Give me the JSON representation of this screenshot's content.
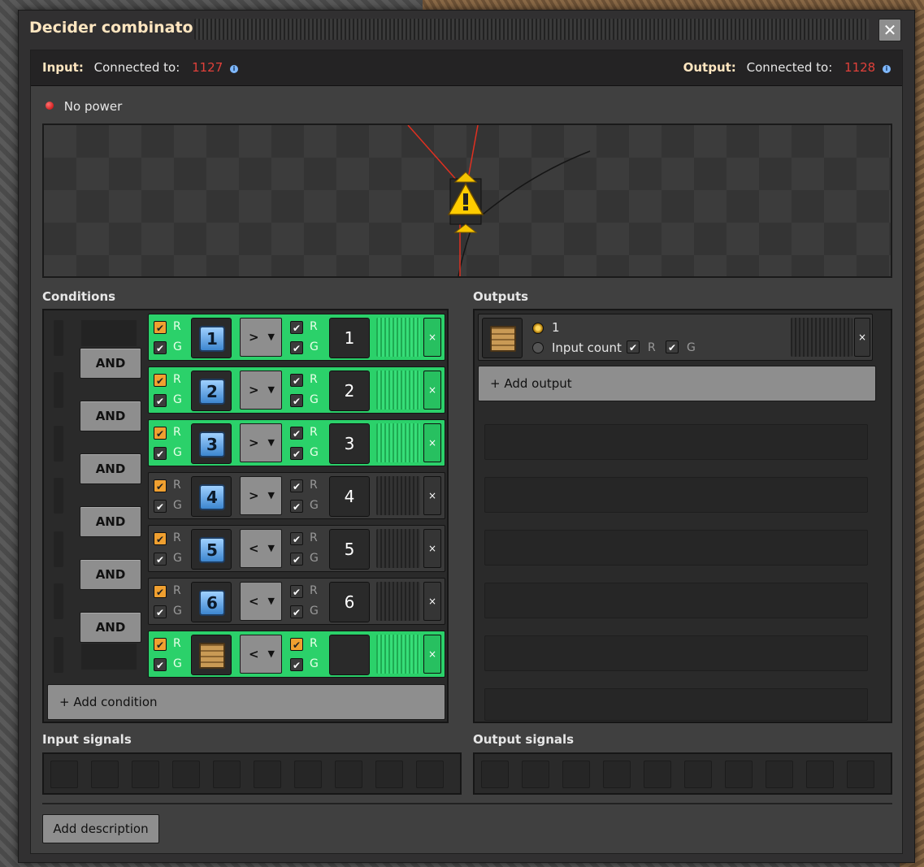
{
  "window": {
    "title": "Decider combinator",
    "close_label": "✕"
  },
  "connections": {
    "input": {
      "label": "Input:",
      "text": "Connected to:",
      "network_id": "1127"
    },
    "output": {
      "label": "Output:",
      "text": "Connected to:",
      "network_id": "1128"
    }
  },
  "status": {
    "text": "No power",
    "color": "#e02020"
  },
  "sections": {
    "conditions": "Conditions",
    "outputs": "Outputs",
    "input_signals": "Input signals",
    "output_signals": "Output signals"
  },
  "conditions": {
    "joiner_label": "AND",
    "add_label": "+ Add condition",
    "remove_label": "×",
    "rows": [
      {
        "signal": "1",
        "signal_icon": "signal-1-icon",
        "comparator": ">",
        "constant": "1",
        "active": true
      },
      {
        "signal": "2",
        "signal_icon": "signal-2-icon",
        "comparator": ">",
        "constant": "2",
        "active": true
      },
      {
        "signal": "3",
        "signal_icon": "signal-3-icon",
        "comparator": ">",
        "constant": "3",
        "active": true
      },
      {
        "signal": "4",
        "signal_icon": "signal-4-icon",
        "comparator": ">",
        "constant": "4",
        "active": false
      },
      {
        "signal": "5",
        "signal_icon": "signal-5-icon",
        "comparator": "<",
        "constant": "5",
        "active": false
      },
      {
        "signal": "6",
        "signal_icon": "signal-6-icon",
        "comparator": "<",
        "constant": "6",
        "active": false
      },
      {
        "signal": "",
        "signal_icon": "wooden-chest-icon",
        "comparator": "<",
        "constant": "",
        "active": true
      }
    ],
    "red_label": "R",
    "green_label": "G"
  },
  "outputs": {
    "rows": [
      {
        "signal_icon": "wooden-chest-icon",
        "value": "1",
        "alt_text": "Input count",
        "red_label": "R",
        "green_label": "G"
      }
    ],
    "add_label": "+ Add output",
    "remove_label": "×"
  },
  "footer": {
    "add_description": "Add description"
  },
  "colors": {
    "active_row": "#2bd16a",
    "button": "#8e8e8e",
    "title": "#ffe6c0",
    "network_id": "#e0403a"
  }
}
